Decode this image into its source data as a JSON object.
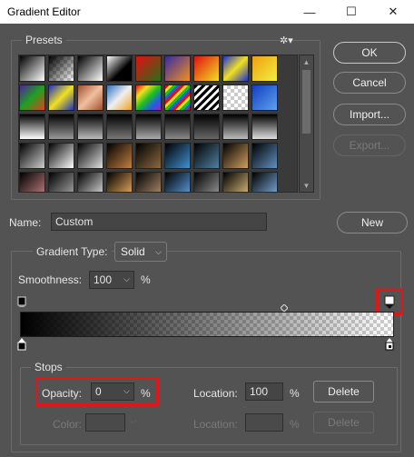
{
  "window": {
    "title": "Gradient Editor",
    "minimize_glyph": "—",
    "maximize_glyph": "☐",
    "close_glyph": "✕"
  },
  "presets": {
    "label": "Presets",
    "gear_glyph": "✲▾"
  },
  "buttons": {
    "ok": "OK",
    "cancel": "Cancel",
    "import": "Import...",
    "export": "Export...",
    "new": "New",
    "delete": "Delete",
    "delete_disabled": "Delete"
  },
  "name": {
    "label": "Name:",
    "value": "Custom"
  },
  "gradient": {
    "type_label": "Gradient Type:",
    "type_value": "Solid",
    "smoothness_label": "Smoothness:",
    "smoothness_value": "100",
    "smoothness_unit": "%"
  },
  "stops": {
    "label": "Stops",
    "opacity_label": "Opacity:",
    "opacity_value": "0",
    "opacity_unit": "%",
    "opacity_location_label": "Location:",
    "opacity_location_value": "100",
    "opacity_location_unit": "%",
    "color_label": "Color:",
    "color_location_label": "Location:",
    "color_location_unit": "%"
  },
  "colors": {
    "highlight": "#e0161a",
    "panel": "#535353"
  }
}
